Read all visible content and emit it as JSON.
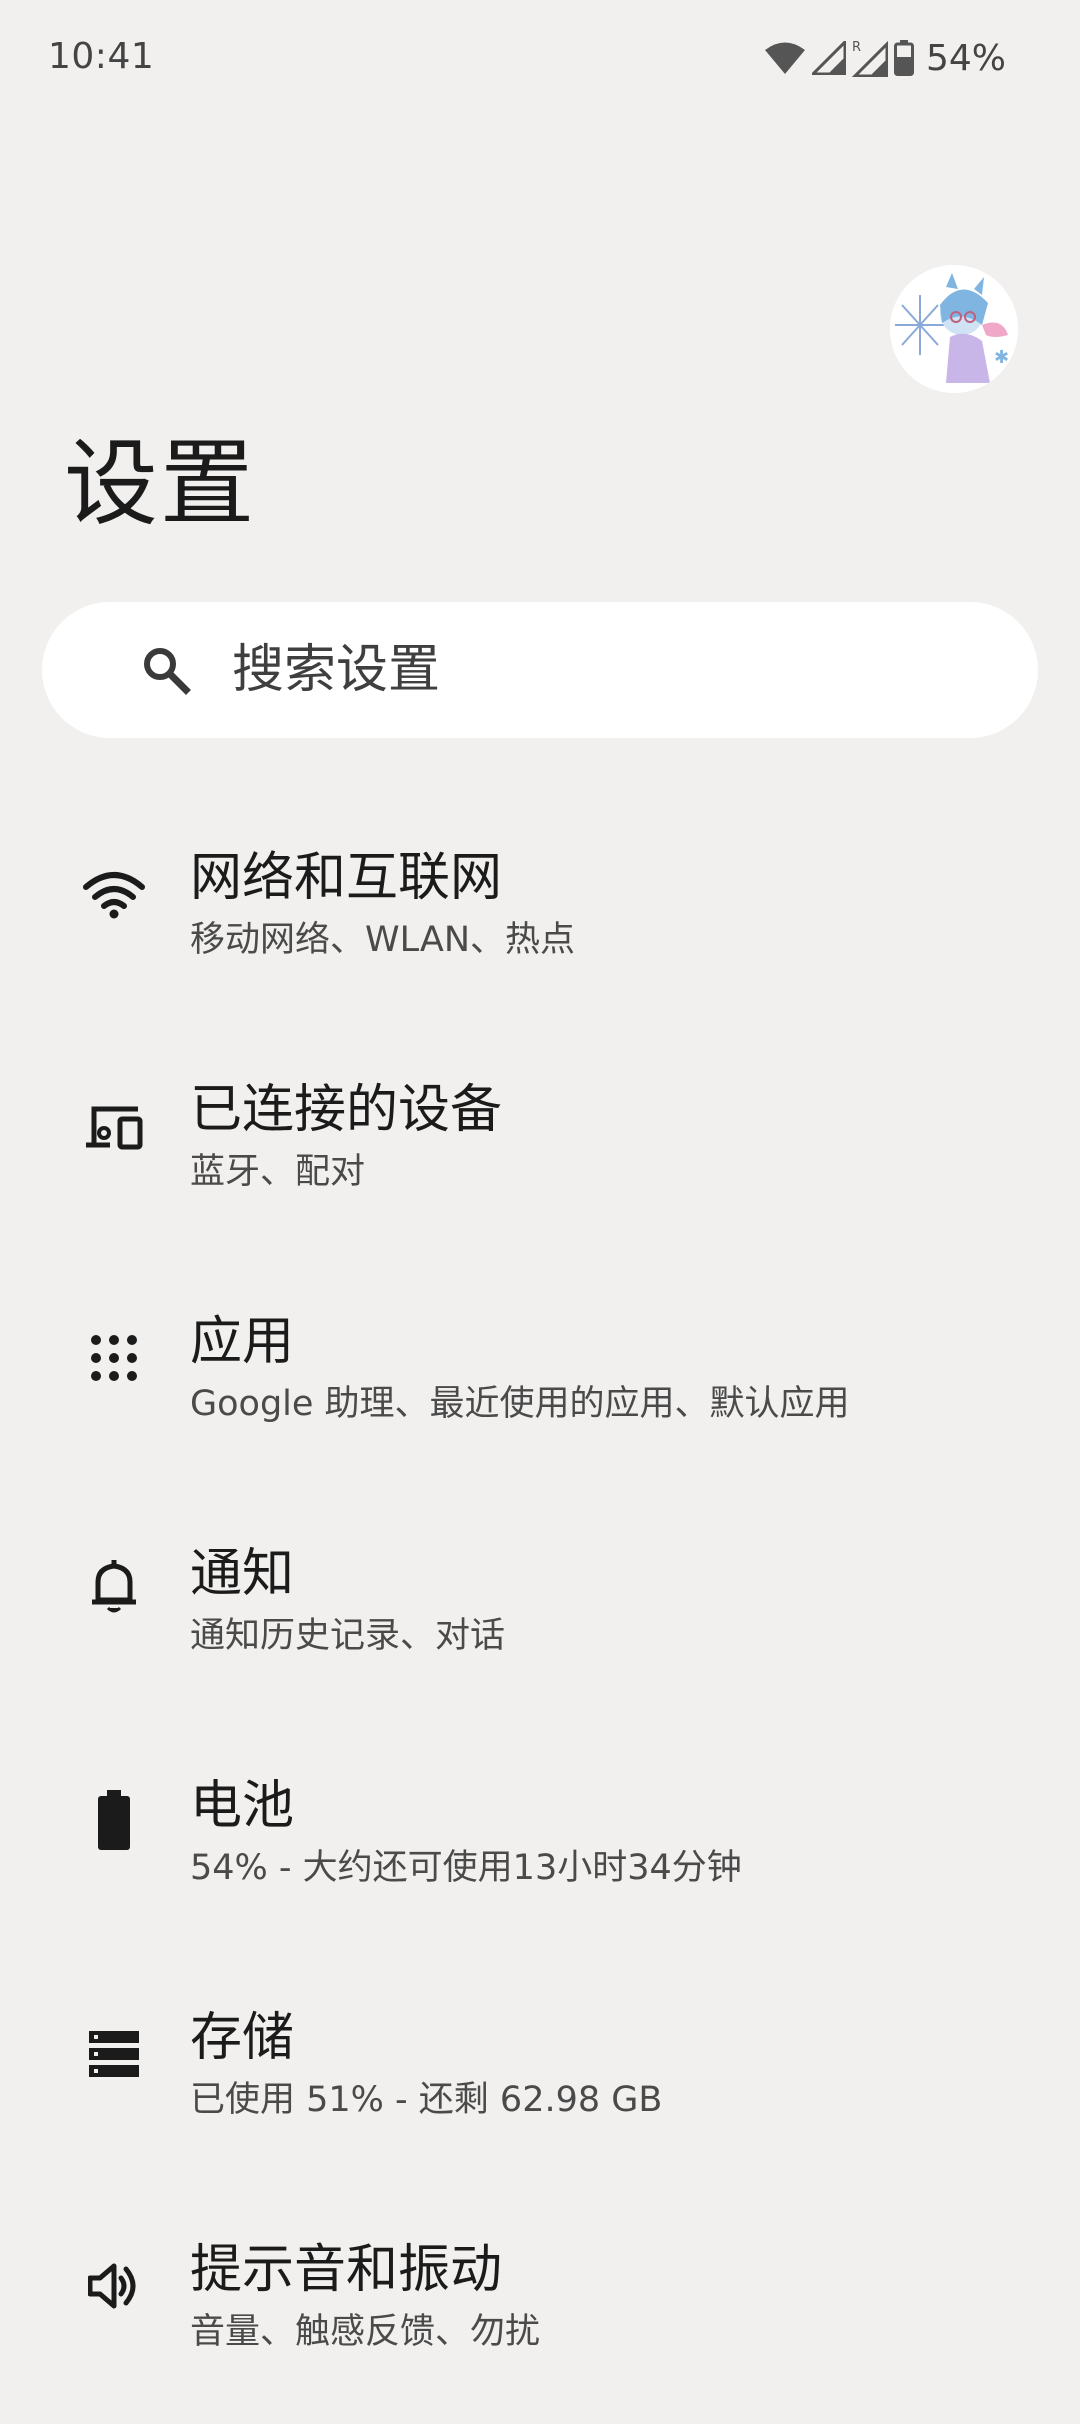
{
  "status_bar": {
    "time": "10:41",
    "battery_percent": "54%",
    "icons": [
      "wifi-icon",
      "cell-signal-icon",
      "cell-signal-roaming-icon",
      "battery-icon"
    ],
    "roaming_label": "R"
  },
  "header": {
    "title": "设置",
    "avatar": "user-avatar"
  },
  "search": {
    "placeholder": "搜索设置"
  },
  "settings": {
    "items": [
      {
        "title": "网络和互联网",
        "subtitle": "移动网络、WLAN、热点",
        "icon": "wifi-icon"
      },
      {
        "title": "已连接的设备",
        "subtitle": "蓝牙、配对",
        "icon": "connected-devices-icon"
      },
      {
        "title": "应用",
        "subtitle": "Google 助理、最近使用的应用、默认应用",
        "icon": "apps-grid-icon"
      },
      {
        "title": "通知",
        "subtitle": "通知历史记录、对话",
        "icon": "bell-icon"
      },
      {
        "title": "电池",
        "subtitle": "54% - 大约还可使用13小时34分钟",
        "icon": "battery-icon"
      },
      {
        "title": "存储",
        "subtitle": "已使用 51% - 还剩 62.98 GB",
        "icon": "storage-icon"
      },
      {
        "title": "提示音和振动",
        "subtitle": "音量、触感反馈、勿扰",
        "icon": "volume-icon"
      }
    ]
  },
  "colors": {
    "background": "#f1f0ef",
    "search_background": "#ffffff",
    "text_primary": "#1b1b1b",
    "text_secondary": "#4a4a4a"
  }
}
